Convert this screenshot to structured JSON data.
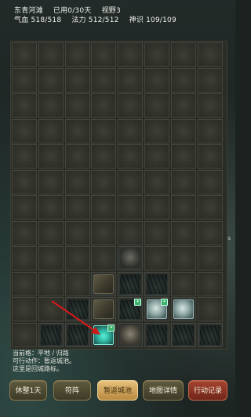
{
  "hud": {
    "location": "东青河滩",
    "days_used": "已用0/30天",
    "vision": "视野3",
    "hp": "气血 518/518",
    "mp": "法力 512/512",
    "spirit": "神识 109/109"
  },
  "info": {
    "terrain": "当前格：平地 / 归路",
    "actions": "可行动作：暂返城池。",
    "hint": "这里是回城路标。"
  },
  "buttons": {
    "rest": "休整1天",
    "formation": "符阵",
    "return_city": "暂返城池",
    "map_detail": "地图详情",
    "action_log": "行动记录"
  },
  "badge_icon": "✦",
  "edge_marker": "s",
  "colors": {
    "accent_gold": "#e7c07a",
    "accent_red": "#a6432f",
    "teal_tile": "#2fb9a5",
    "arrow": "#d11a1a"
  }
}
